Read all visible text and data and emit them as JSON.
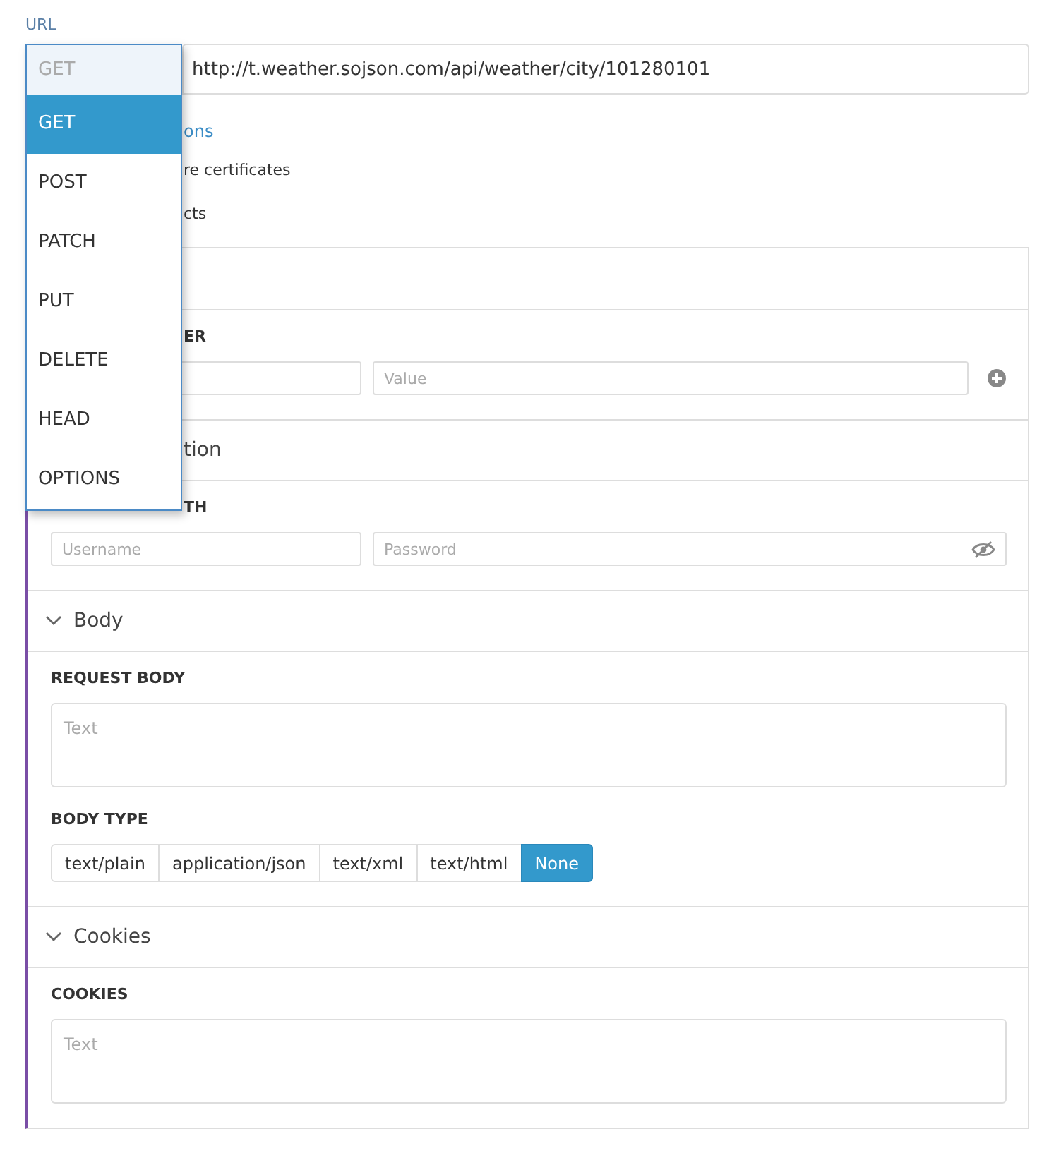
{
  "url_label": "URL",
  "method_select": {
    "value": "GET",
    "options": [
      {
        "label": "GET",
        "selected": true
      },
      {
        "label": "POST",
        "selected": false
      },
      {
        "label": "PATCH",
        "selected": false
      },
      {
        "label": "PUT",
        "selected": false
      },
      {
        "label": "DELETE",
        "selected": false
      },
      {
        "label": "HEAD",
        "selected": false
      },
      {
        "label": "OPTIONS",
        "selected": false
      }
    ]
  },
  "url": {
    "value": "http://t.weather.sojson.com/api/weather/city/101280101"
  },
  "options_link": "ons",
  "option_rows": [
    "re certificates",
    "cts"
  ],
  "sections": [
    {
      "kind": "headers",
      "label": "ER",
      "value_placeholder": "Value"
    },
    {
      "kind": "auth",
      "title": "tion",
      "label": "TH",
      "username_placeholder": "Username",
      "password_placeholder": "Password"
    },
    {
      "kind": "body",
      "title": "Body",
      "expanded": true,
      "request_label": "REQUEST BODY",
      "request_placeholder": "Text",
      "type_label": "BODY TYPE",
      "types": [
        {
          "label": "text/plain",
          "selected": false
        },
        {
          "label": "application/json",
          "selected": false
        },
        {
          "label": "text/xml",
          "selected": false
        },
        {
          "label": "text/html",
          "selected": false
        },
        {
          "label": "None",
          "selected": true
        }
      ]
    },
    {
      "kind": "cookies",
      "title": "Cookies",
      "expanded": true,
      "label": "COOKIES",
      "placeholder": "Text"
    }
  ]
}
